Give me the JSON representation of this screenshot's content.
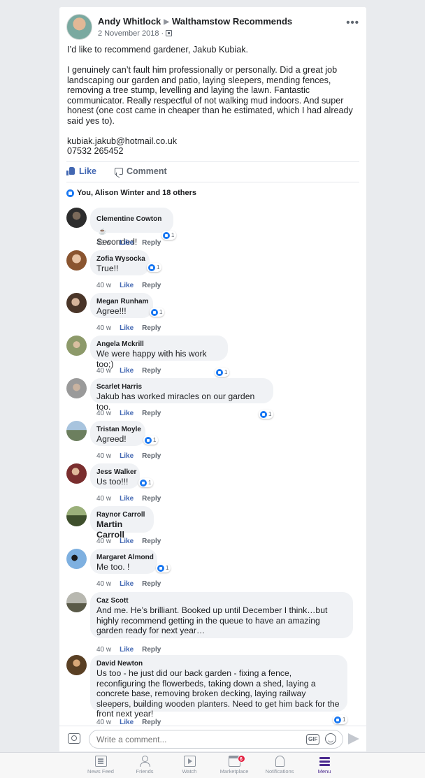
{
  "post": {
    "author": "Andy Whitlock",
    "group": "Walthamstow Recommends",
    "date": "2 November 2018 ·",
    "body": [
      "I’d like to recommend gardener, Jakub Kubiak.",
      "I genuinely can’t fault him professionally or personally. Did a great job landscaping our garden and patio, laying sleepers, mending fences, removing a tree stump, levelling and laying the lawn. Fantastic communicator. Really respectful of not walking mud indoors. And super honest (one cost came in cheaper than he estimated, which I had already said yes to).",
      "kubiak.jakub@hotmail.co.uk",
      "07532 265452"
    ],
    "like_label": "Like",
    "comment_label": "Comment",
    "reactions_text": "You, Alison Winter and 18 others"
  },
  "comments": [
    {
      "name": "Clementine Cowton",
      "text": "Seconded!",
      "time": "40 w",
      "like": "Like",
      "reply": "Reply",
      "reactions": "1",
      "avatar_color": "#4a4a4a"
    },
    {
      "name": "Zofia Wysocka",
      "text": "True!!",
      "time": "40 w",
      "like": "Like",
      "reply": "Reply",
      "reactions": "1",
      "avatar_color": "#b57a4d"
    },
    {
      "name": "Megan Runham",
      "text": "Agree!!!",
      "time": "40 w",
      "like": "Like",
      "reply": "Reply",
      "reactions": "1",
      "avatar_color": "#7a5a4a"
    },
    {
      "name": "Angela Mckrill",
      "text": "We were happy with his work too;)",
      "time": "40 w",
      "like": "Like",
      "reply": "Reply",
      "reactions": "1",
      "avatar_color": "#9aa07a"
    },
    {
      "name": "Scarlet Harris",
      "text": "Jakub has worked miracles on our garden too.",
      "time": "40 w",
      "like": "Like",
      "reply": "Reply",
      "reactions": "1",
      "avatar_color": "#8c8c8c"
    },
    {
      "name": "Tristan Moyle",
      "text": "Agreed!",
      "time": "40 w",
      "like": "Like",
      "reply": "Reply",
      "reactions": "1",
      "avatar_color": "#7b9bb8"
    },
    {
      "name": "Jess Walker",
      "text": "Us too!!!",
      "time": "40 w",
      "like": "Like",
      "reply": "Reply",
      "reactions": "1",
      "avatar_color": "#a0503a"
    },
    {
      "name": "Raynor Carroll",
      "text": "Martin Carroll",
      "time": "40 w",
      "like": "Like",
      "reply": "Reply",
      "reactions": "",
      "avatar_color": "#4d6b3a"
    },
    {
      "name": "Margaret Almond",
      "text": "Me too.  !",
      "time": "40 w",
      "like": "Like",
      "reply": "Reply",
      "reactions": "1",
      "avatar_color": "#5d89b8"
    },
    {
      "name": "Caz Scott",
      "text": "And me. He’s brilliant.  Booked up until December I think…but highly recommend getting in the queue to have an amazing garden ready for next year…",
      "time": "40 w",
      "like": "Like",
      "reply": "Reply",
      "reactions": "",
      "avatar_color": "#6a6a5a"
    },
    {
      "name": "David Newton",
      "text": "Us too - he just did our back garden - fixing a fence, reconfiguring the flowerbeds, taking down a shed, laying a concrete base, removing broken decking, laying railway sleepers, building wooden planters. Need to get him back for the front next year!",
      "time": "40 w",
      "like": "Like",
      "reply": "Reply",
      "reactions": "1",
      "avatar_color": "#8a6a40"
    }
  ],
  "composer": {
    "placeholder": "Write a comment...",
    "gif_label": "GIF"
  },
  "tabbar": {
    "items": [
      {
        "label": "News Feed",
        "icon": "news-feed-icon"
      },
      {
        "label": "Friends",
        "icon": "friends-icon"
      },
      {
        "label": "Watch",
        "icon": "watch-icon"
      },
      {
        "label": "Marketplace",
        "icon": "marketplace-icon",
        "badge": "6"
      },
      {
        "label": "Notifications",
        "icon": "bell-icon"
      },
      {
        "label": "Menu",
        "icon": "menu-icon"
      }
    ]
  },
  "colors": {
    "accent": "#4267b2",
    "active_tab": "#4b2a8f",
    "badge": "#e41e3f"
  }
}
